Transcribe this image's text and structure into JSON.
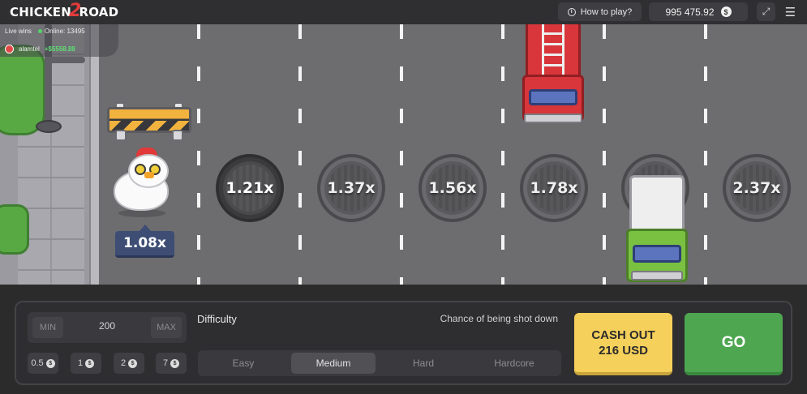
{
  "header": {
    "logo_text_1": "CHICKEN",
    "logo_text_2": "2",
    "logo_text_3": "ROAD",
    "how_to_play_label": "How to play?",
    "balance": "995 475.92",
    "currency_icon": "$",
    "fullscreen_icon": "expand-icon",
    "menu_icon": "hamburger-menu-icon"
  },
  "live": {
    "live_wins_label": "Live wins",
    "online_label": "Online: 13495",
    "recent_user": "alamtel",
    "recent_win": "+$5558.88"
  },
  "game": {
    "current_multiplier": "1.08x",
    "multipliers": [
      "1.21x",
      "1.37x",
      "1.56x",
      "1.78x",
      "2.37x"
    ],
    "colors": {
      "road": "#6d6c6f",
      "tag": "#3d4d74"
    }
  },
  "controls": {
    "bet": {
      "min_label": "MIN",
      "value": "200",
      "max_label": "MAX"
    },
    "quick_bets": [
      "0.5",
      "1",
      "2",
      "7"
    ],
    "difficulty_label": "Difficulty",
    "chance_label": "Chance of being shot down",
    "difficulties": [
      "Easy",
      "Medium",
      "Hard",
      "Hardcore"
    ],
    "selected_difficulty": "Medium",
    "cashout_line1": "CASH OUT",
    "cashout_line2": "216 USD",
    "go_label": "GO",
    "colors": {
      "cashout": "#f5d05a",
      "go": "#4ea651"
    }
  }
}
